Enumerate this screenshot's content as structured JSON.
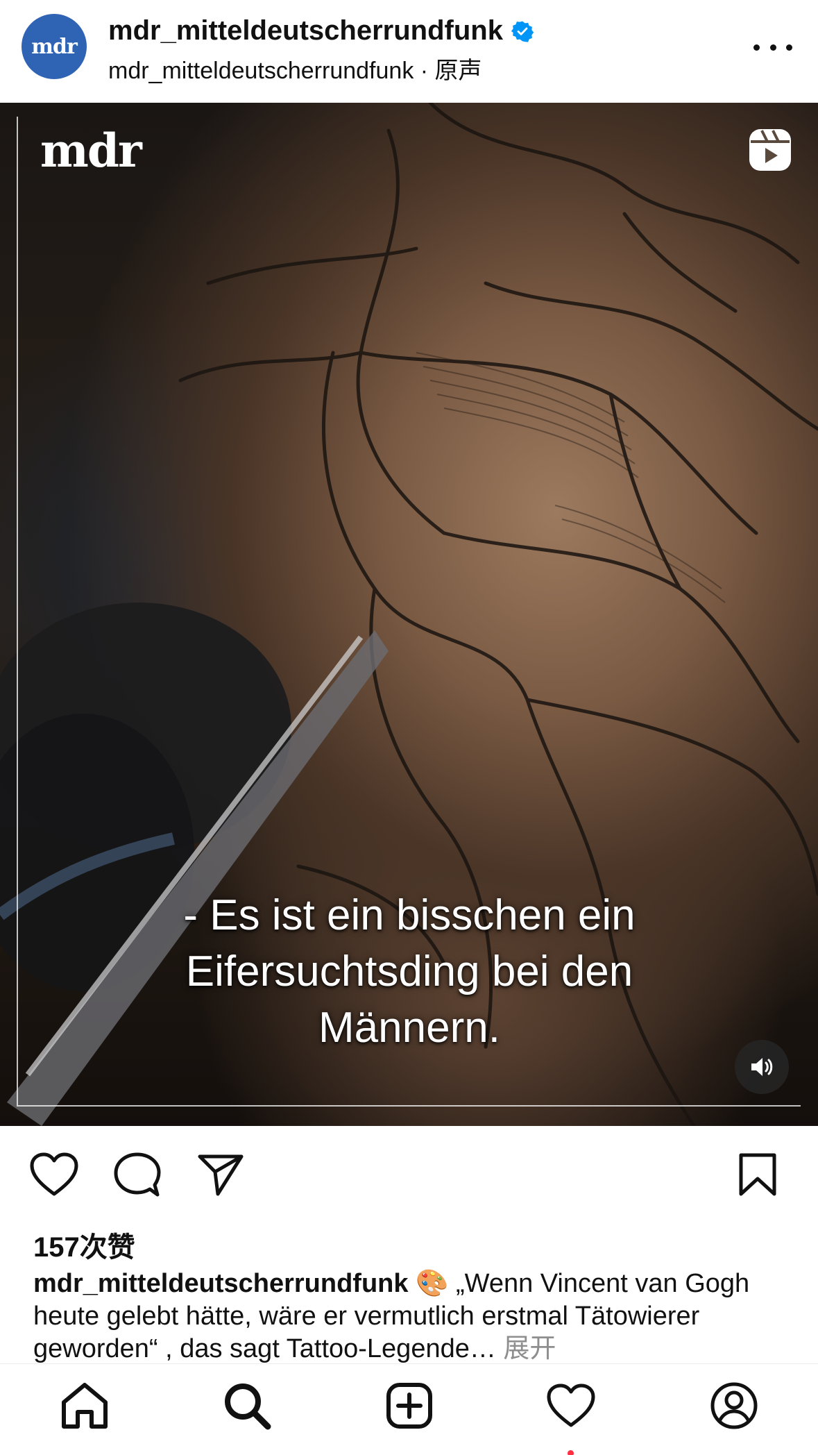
{
  "header": {
    "avatar_text": "mdr",
    "username": "mdr_mitteldeutscherrundfunk",
    "verified": true,
    "subline": "mdr_mitteldeutscherrundfunk · 原声",
    "more_icon": "more-horizontal-icon"
  },
  "video": {
    "logo_text": "mdr",
    "reels_icon": "reels-icon",
    "subtitle_line1": "- Es ist ein bisschen ein",
    "subtitle_line2": "Eifersuchtsding bei den",
    "subtitle_line3": "Männern.",
    "volume_icon": "volume-on-icon"
  },
  "actions": {
    "like_icon": "heart-icon",
    "comment_icon": "comment-icon",
    "share_icon": "send-icon",
    "save_icon": "bookmark-icon"
  },
  "post": {
    "likes": "157次赞",
    "caption_user": "mdr_mitteldeutscherrundfunk",
    "caption_emoji": "🎨",
    "caption_text": " „Wenn Vincent van Gogh heute gelebt hätte, wäre er vermutlich erstmal Tätowierer geworden“ , das sagt Tattoo-Legende…",
    "more_label": " 展开"
  },
  "bottom_nav": {
    "items": [
      "home-icon",
      "search-icon",
      "create-icon",
      "activity-heart-icon",
      "profile-icon"
    ],
    "has_notification_dot": true
  },
  "colors": {
    "verified_blue": "#0095f6",
    "avatar_blue": "#2f63b3",
    "notification_red": "#ff3040",
    "muted_text": "#8e8e8e"
  }
}
